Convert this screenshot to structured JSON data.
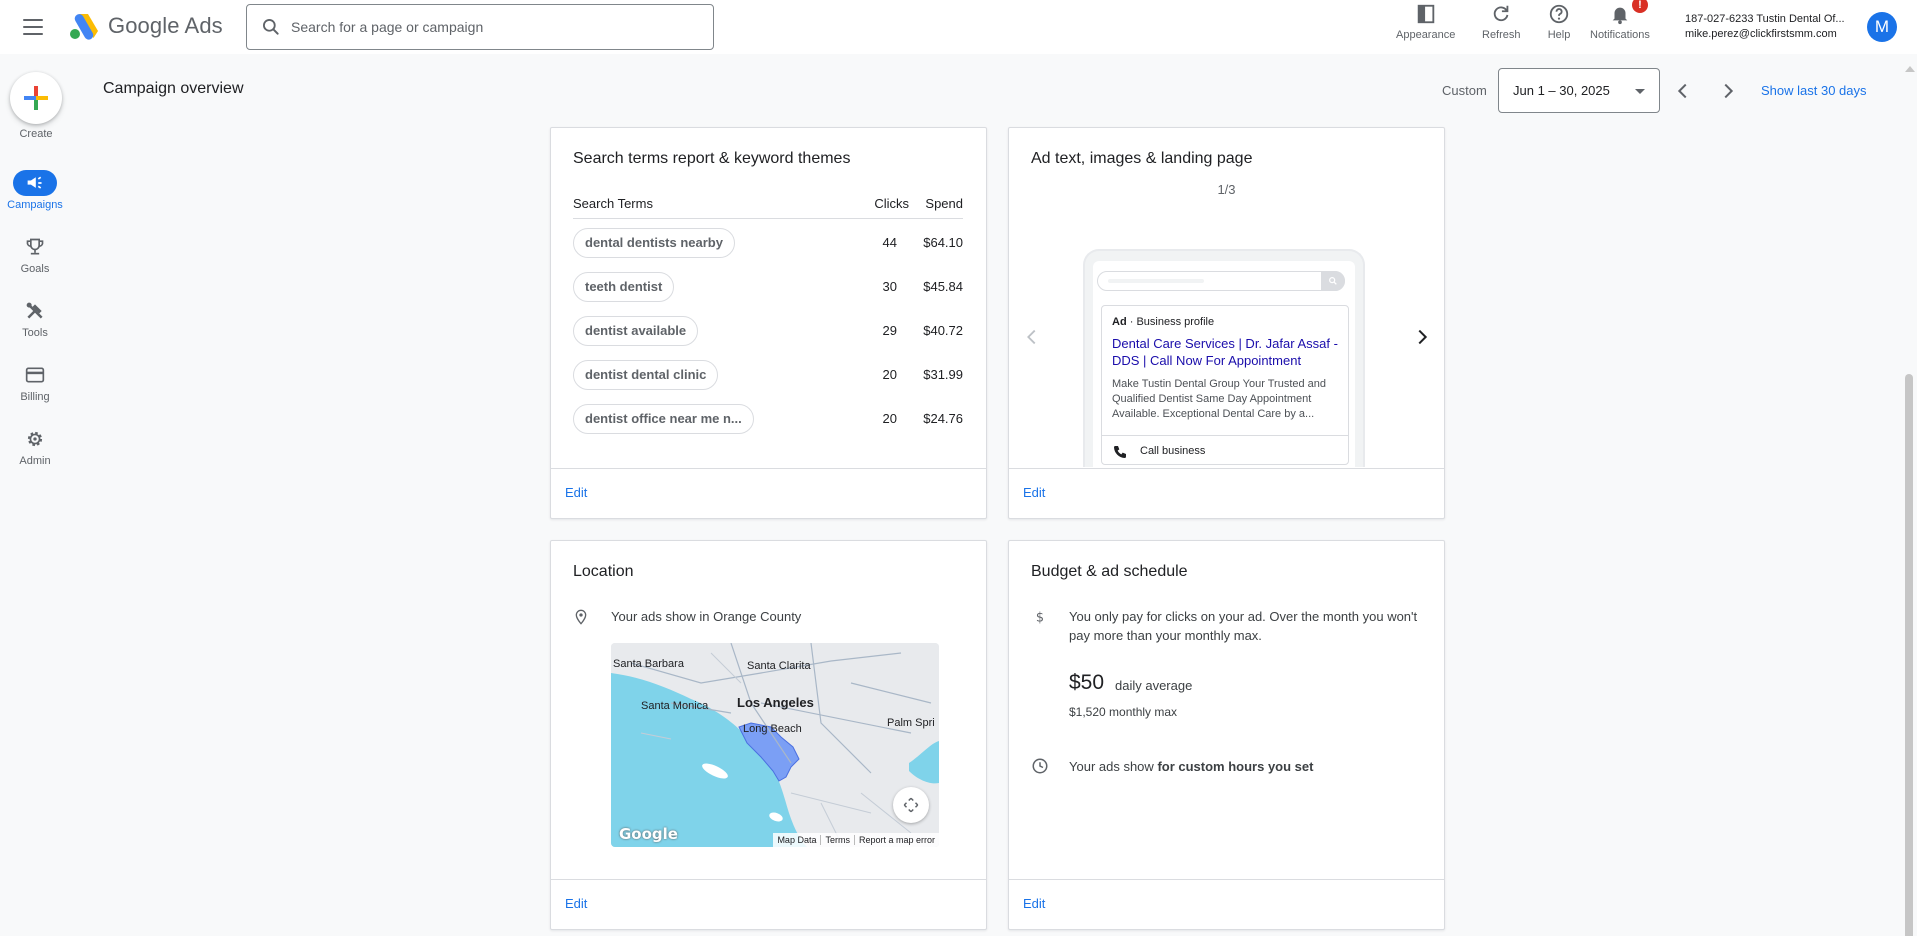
{
  "app": {
    "name": "Google Ads"
  },
  "search": {
    "placeholder": "Search for a page or campaign"
  },
  "toolbar": {
    "appearance": "Appearance",
    "refresh": "Refresh",
    "help": "Help",
    "notifications": "Notifications",
    "notifications_badge": "!"
  },
  "account": {
    "line1": "187-027-6233 Tustin Dental Of...",
    "line2": "mike.perez@clickfirstsmm.com",
    "avatar_letter": "M"
  },
  "nav": {
    "create": "Create",
    "items": [
      {
        "label": "Campaigns",
        "icon": "megaphone-icon",
        "active": true
      },
      {
        "label": "Goals",
        "icon": "trophy-icon"
      },
      {
        "label": "Tools",
        "icon": "tools-icon"
      },
      {
        "label": "Billing",
        "icon": "credit-card-icon"
      },
      {
        "label": "Admin",
        "icon": "gear-icon"
      }
    ]
  },
  "header": {
    "title": "Campaign overview",
    "custom_label": "Custom",
    "date_range": "Jun 1 – 30, 2025",
    "show_last": "Show last 30 days"
  },
  "search_terms": {
    "title": "Search terms report & keyword themes",
    "columns": [
      "Search Terms",
      "Clicks",
      "Spend"
    ],
    "rows": [
      {
        "term": "dental dentists nearby",
        "clicks": "44",
        "spend": "$64.10"
      },
      {
        "term": "teeth dentist",
        "clicks": "30",
        "spend": "$45.84"
      },
      {
        "term": "dentist available",
        "clicks": "29",
        "spend": "$40.72"
      },
      {
        "term": "dentist dental clinic",
        "clicks": "20",
        "spend": "$31.99"
      },
      {
        "term": "dentist office near me n...",
        "clicks": "20",
        "spend": "$24.76"
      }
    ],
    "edit": "Edit"
  },
  "ad_preview": {
    "title": "Ad text, images & landing page",
    "pager": "1/3",
    "ad_label": "Ad",
    "ad_source": "Business profile",
    "headline": "Dental Care Services | Dr. Jafar Assaf - DDS | Call Now For Appointment",
    "description": "Make Tustin Dental Group Your Trusted and Qualified Dentist Same Day Appointment Available. Exceptional Dental Care by a...",
    "call": "Call business",
    "edit": "Edit"
  },
  "location": {
    "title": "Location",
    "text": "Your ads show in Orange County",
    "map_labels": {
      "santa_barbara": "Santa Barbara",
      "santa_clarita": "Santa Clarita",
      "los_angeles": "Los Angeles",
      "santa_monica": "Santa Monica",
      "long_beach": "Long Beach",
      "palm_springs": "Palm Spri"
    },
    "map_footer": [
      "Map Data",
      "Terms",
      "Report a map error"
    ],
    "google_watermark": "Google",
    "edit": "Edit"
  },
  "budget": {
    "title": "Budget & ad schedule",
    "pay_text": "You only pay for clicks on your ad. Over the month you won't pay more than your monthly max.",
    "amount": "$50",
    "amount_label": "daily average",
    "monthly_max": "$1,520 monthly max",
    "schedule_prefix": "Your ads show",
    "schedule_bold": "for custom hours you set",
    "edit": "Edit"
  },
  "colors": {
    "accent": "#1a73e8",
    "badge": "#d93025",
    "ad_link": "#1a0dab",
    "map_water": "#7fd3ea",
    "map_region": "#7b9ff5"
  }
}
